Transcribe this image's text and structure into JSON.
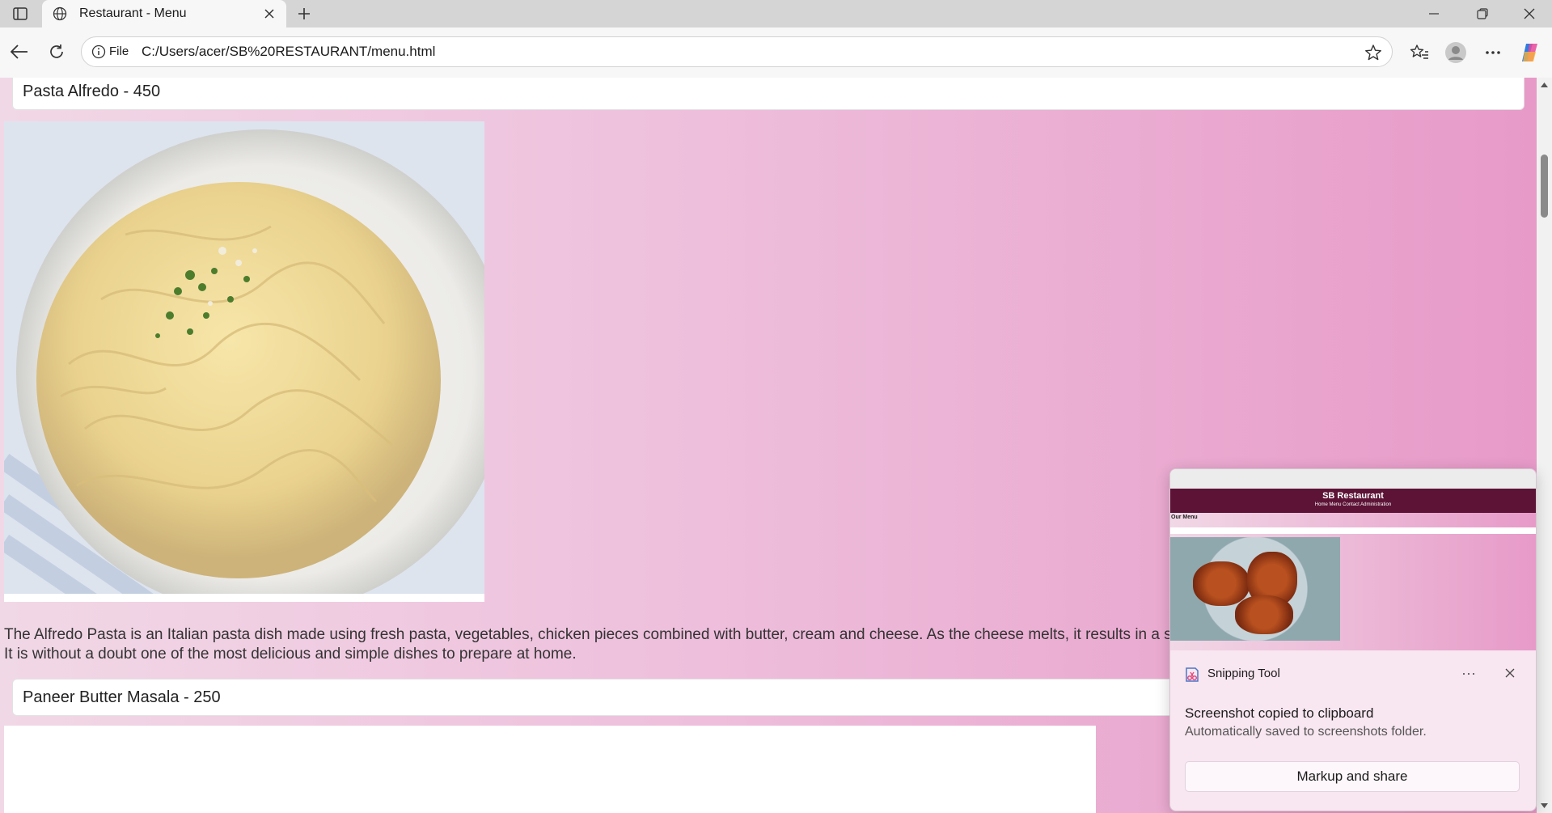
{
  "browser": {
    "tab_title": "Restaurant - Menu",
    "address_scheme_label": "File",
    "address_url": "C:/Users/acer/SB%20RESTAURANT/menu.html"
  },
  "menu": {
    "item1_label": "Pasta Alfredo - 450",
    "item1_description": "The Alfredo Pasta is an Italian pasta dish made using fresh pasta, vegetables, chicken pieces combined with butter, cream and cheese. As the cheese melts, it results in a smooth, creamy sauce that beautifully coats the pasta. It is without a doubt one of the most delicious and simple dishes to prepare at home.",
    "item2_label": "Paneer Butter Masala - 250"
  },
  "snipping_tool": {
    "app_name": "Snipping Tool",
    "message": "Screenshot copied to clipboard",
    "submessage": "Automatically saved to screenshots folder.",
    "action_label": "Markup and share",
    "more_glyph": "···",
    "preview": {
      "site_title": "SB Restaurant",
      "nav": "Home    Menu    Contact    Administration",
      "heading": "Our Menu"
    }
  },
  "colors": {
    "page_gradient_start": "#f1d8e6",
    "page_gradient_end": "#e79ac8",
    "preview_header": "#5c1336"
  }
}
